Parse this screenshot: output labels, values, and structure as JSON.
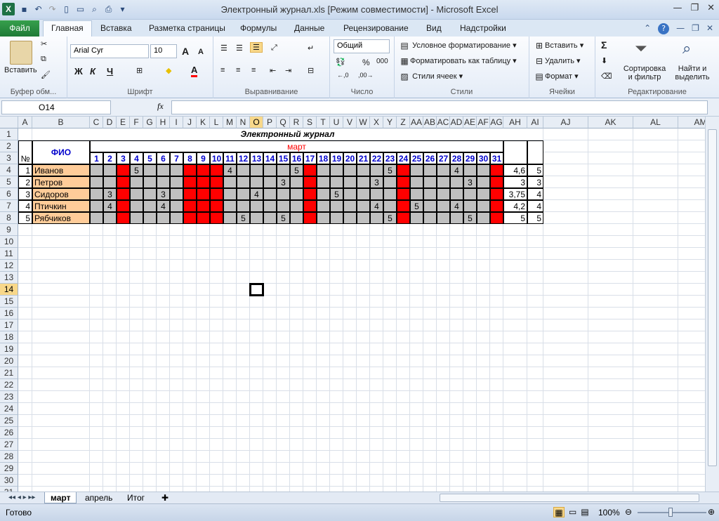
{
  "window": {
    "title": "Электронный журнал.xls  [Режим совместимости]  -  Microsoft Excel",
    "app_letter": "X"
  },
  "qat_icons": [
    "save-icon",
    "undo-icon",
    "redo-icon",
    "new-icon",
    "open-icon",
    "print-preview-icon",
    "print-icon",
    "customize-icon"
  ],
  "tabs": {
    "file": "Файл",
    "items": [
      "Главная",
      "Вставка",
      "Разметка страницы",
      "Формулы",
      "Данные",
      "Рецензирование",
      "Вид",
      "Надстройки"
    ],
    "active": "Главная"
  },
  "ribbon": {
    "clipboard": {
      "paste": "Вставить",
      "label": "Буфер обм..."
    },
    "font": {
      "name": "Arial Cyr",
      "size": "10",
      "bold": "Ж",
      "italic": "К",
      "underline": "Ч",
      "grow": "A",
      "shrink": "A",
      "label": "Шрифт"
    },
    "alignment": {
      "label": "Выравнивание"
    },
    "number": {
      "format": "Общий",
      "percent": "%",
      "thousands": "000",
      "label": "Число"
    },
    "styles": {
      "conditional": "Условное форматирование",
      "as_table": "Форматировать как таблицу",
      "cell_styles": "Стили ячеек",
      "label": "Стили"
    },
    "cells": {
      "insert": "Вставить",
      "delete": "Удалить",
      "format": "Формат",
      "label": "Ячейки"
    },
    "editing": {
      "sigma": "Σ",
      "sort": "Сортировка",
      "sort2": "и фильтр",
      "find": "Найти и",
      "find2": "выделить",
      "label": "Редактирование"
    }
  },
  "formula_bar": {
    "name_box": "O14",
    "fx": "fx",
    "value": ""
  },
  "columns": [
    "A",
    "B",
    "C",
    "D",
    "E",
    "F",
    "G",
    "H",
    "I",
    "J",
    "K",
    "L",
    "M",
    "N",
    "O",
    "P",
    "Q",
    "R",
    "S",
    "T",
    "U",
    "V",
    "W",
    "X",
    "Y",
    "Z",
    "AA",
    "AB",
    "AC",
    "AD",
    "AE",
    "AF",
    "AG",
    "AH",
    "AI",
    "AJ",
    "AK",
    "AL",
    "AM"
  ],
  "rows": [
    "1",
    "2",
    "3",
    "4",
    "5",
    "6",
    "7",
    "8",
    "9",
    "10",
    "11",
    "12",
    "13",
    "14",
    "15",
    "16",
    "17",
    "18",
    "19",
    "20",
    "21",
    "22",
    "23",
    "24",
    "25",
    "26",
    "27",
    "28",
    "29",
    "30",
    "31"
  ],
  "selected": {
    "column": "O",
    "row": "14"
  },
  "journal": {
    "title": "Электронный журнал",
    "month": "март",
    "fio_header": "ФИО",
    "num_header": "№",
    "days": [
      "1",
      "2",
      "3",
      "4",
      "5",
      "6",
      "7",
      "8",
      "9",
      "10",
      "11",
      "12",
      "13",
      "14",
      "15",
      "16",
      "17",
      "18",
      "19",
      "20",
      "21",
      "22",
      "23",
      "24",
      "25",
      "26",
      "27",
      "28",
      "29",
      "30",
      "31"
    ],
    "red_days": [
      3,
      8,
      9,
      10,
      17,
      24,
      31
    ],
    "students": [
      {
        "num": "1",
        "name": "Иванов",
        "grades": {
          "4": "5",
          "11": "4",
          "16": "5",
          "23": "5",
          "28": "4"
        },
        "avg": "4,6",
        "final": "5"
      },
      {
        "num": "2",
        "name": "Петров",
        "grades": {
          "15": "3",
          "22": "3",
          "29": "3"
        },
        "avg": "3",
        "final": "3"
      },
      {
        "num": "3",
        "name": "Сидоров",
        "grades": {
          "2": "3",
          "6": "3",
          "13": "4",
          "19": "5"
        },
        "avg": "3,75",
        "final": "4"
      },
      {
        "num": "4",
        "name": "Птичкин",
        "grades": {
          "2": "4",
          "6": "4",
          "22": "4",
          "25": "5",
          "28": "4"
        },
        "avg": "4,2",
        "final": "4"
      },
      {
        "num": "5",
        "name": "Рябчиков",
        "grades": {
          "12": "5",
          "15": "5",
          "23": "5",
          "29": "5"
        },
        "avg": "5",
        "final": "5"
      }
    ]
  },
  "sheets": {
    "items": [
      "март",
      "апрель",
      "Итог"
    ],
    "active": "март"
  },
  "status": {
    "ready": "Готово",
    "zoom": "100%"
  },
  "colors": {
    "weekend": "#ff0000",
    "grey": "#c0c0c0",
    "name_fill": "#ffcc99",
    "header_blue": "#0000cc",
    "month_red": "#ff0000"
  }
}
